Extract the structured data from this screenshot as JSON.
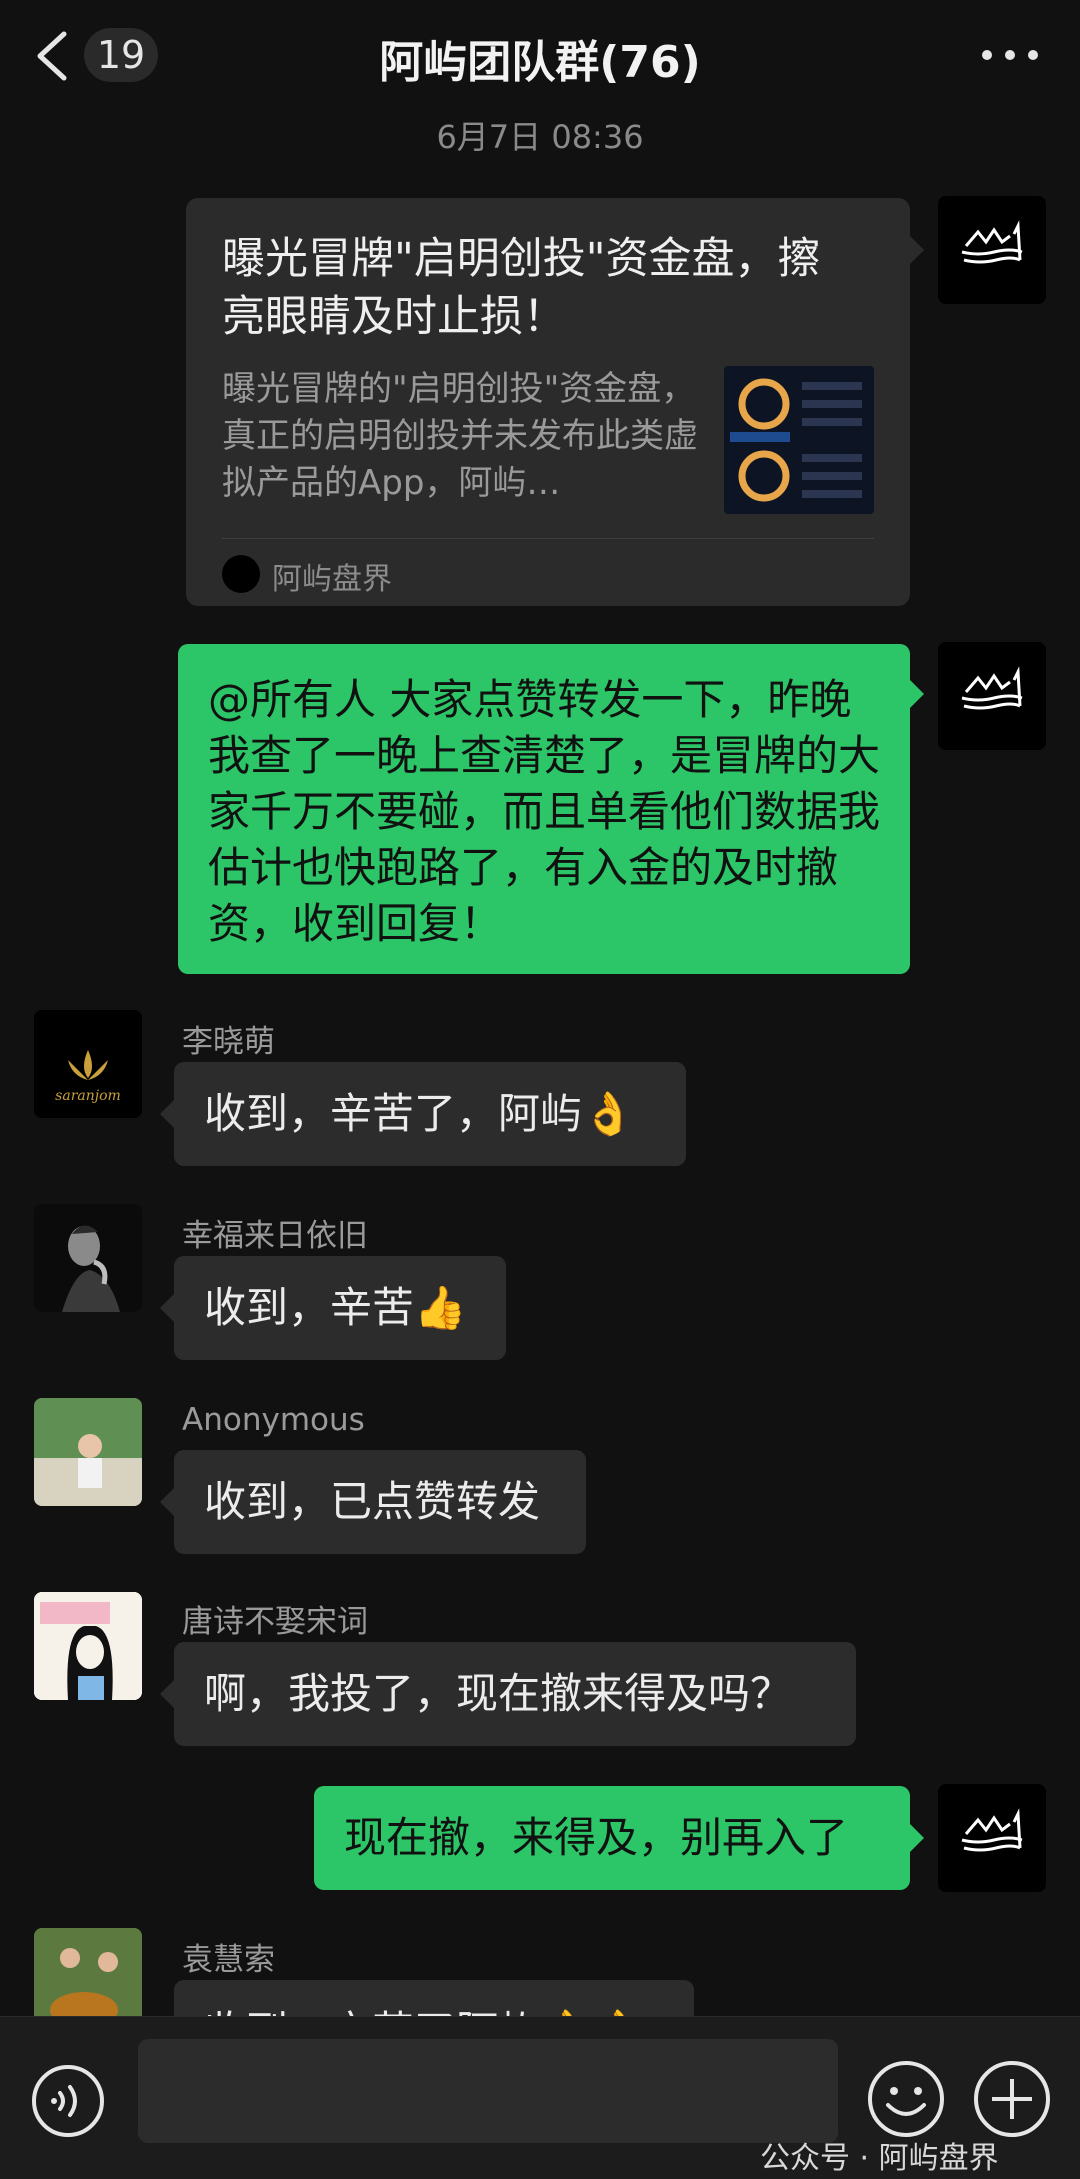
{
  "header": {
    "unread_count": "19",
    "title": "阿屿团队群(76)"
  },
  "timestamp": "6月7日 08:36",
  "article_card": {
    "title": "曝光冒牌\"启明创投\"资金盘，擦亮眼睛及时止损！",
    "description": "曝光冒牌的\"启明创投\"资金盘，真正的启明创投并未发布此类虚拟产品的App，阿屿…",
    "source": "阿屿盘界"
  },
  "messages": [
    {
      "sender": "",
      "text": "@所有人 大家点赞转发一下，昨晚我查了一晚上查清楚了，是冒牌的大家千万不要碰，而且单看他们数据我估计也快跑路了，有入金的及时撤资，收到回复！"
    },
    {
      "sender": "李晓萌",
      "text": "收到，辛苦了，阿屿👌"
    },
    {
      "sender": "幸福来日依旧",
      "text": "收到，辛苦👍"
    },
    {
      "sender": "Anonymous",
      "text": "收到，已点赞转发"
    },
    {
      "sender": "唐诗不娶宋词",
      "text": "啊，我投了，现在撤来得及吗？"
    },
    {
      "sender": "",
      "text": "现在撤，来得及，别再入了"
    },
    {
      "sender": "袁慧索",
      "text": "收到，辛苦了阿屿👌👌"
    }
  ],
  "avatars": {
    "li_logo_text": "saranjom"
  },
  "bottom": {
    "watermark": "公众号 · 阿屿盘界"
  },
  "colors": {
    "background": "#111111",
    "green_bubble": "#2cc567",
    "gray_bubble": "#2c2c2c"
  }
}
